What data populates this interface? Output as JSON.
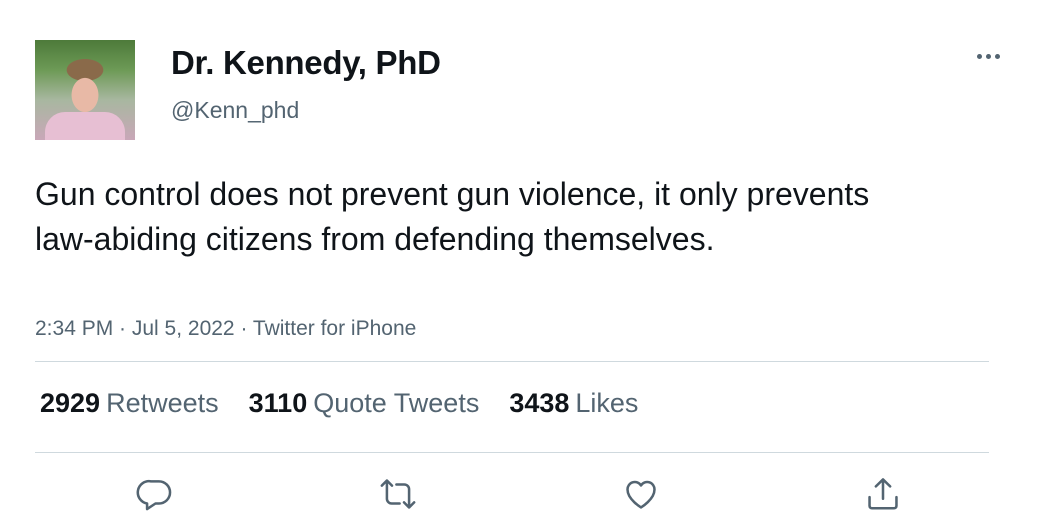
{
  "author": {
    "name": "Dr. Kennedy, PhD",
    "handle": "@Kenn_phd"
  },
  "tweet": {
    "text": "Gun control does not prevent gun violence, it only prevents law-abiding citizens from defending themselves.",
    "meta": "2:34 PM · Jul 5, 2022 · Twitter for iPhone"
  },
  "stats": [
    {
      "count": "2929",
      "label": "Retweets"
    },
    {
      "count": "3110",
      "label": "Quote Tweets"
    },
    {
      "count": "3438",
      "label": "Likes"
    }
  ],
  "icons": {
    "more": "more-horizontal-icon",
    "reply": "reply-icon",
    "retweet": "retweet-icon",
    "like": "heart-icon",
    "share": "share-icon"
  },
  "colors": {
    "text": "#0f1419",
    "secondary": "#536471",
    "divider": "#cfd9de"
  }
}
